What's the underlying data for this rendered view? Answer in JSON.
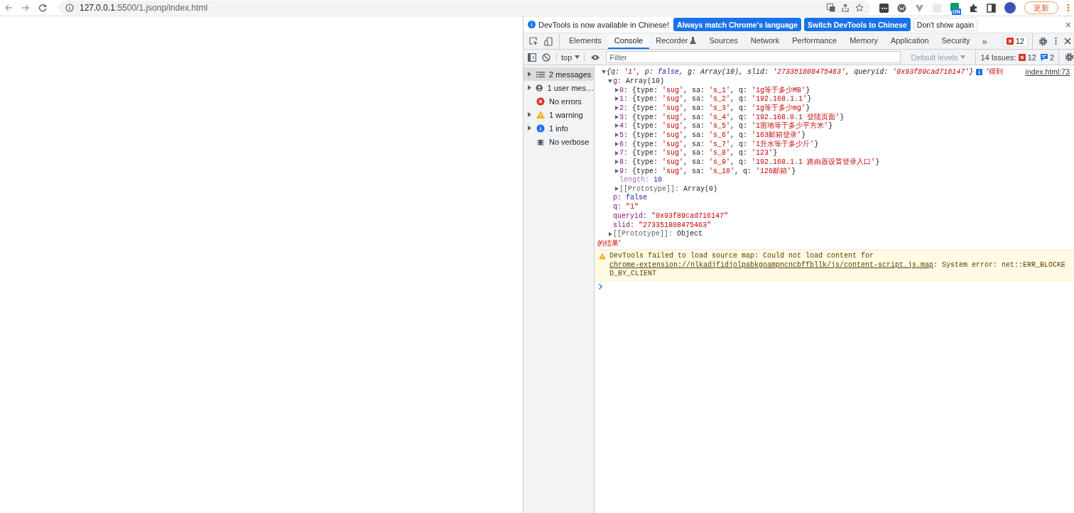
{
  "browser": {
    "address_host": "127.0.0.1",
    "address_rest": ":5500/1.jsonp/index.html",
    "extension_badge": "ON",
    "update_button": "更新"
  },
  "infobar": {
    "message": "DevTools is now available in Chinese!",
    "buttons": [
      {
        "label": "Always match Chrome's language",
        "kind": "primary"
      },
      {
        "label": "Switch DevTools to Chinese",
        "kind": "primary"
      },
      {
        "label": "Don't show again",
        "kind": "plain"
      }
    ],
    "close": "×"
  },
  "tabs": [
    {
      "label": "Elements",
      "selected": false,
      "experimental": false
    },
    {
      "label": "Console",
      "selected": true,
      "experimental": false
    },
    {
      "label": "Recorder",
      "selected": false,
      "experimental": true
    },
    {
      "label": "Sources",
      "selected": false,
      "experimental": false
    },
    {
      "label": "Network",
      "selected": false,
      "experimental": false
    },
    {
      "label": "Performance",
      "selected": false,
      "experimental": false
    },
    {
      "label": "Memory",
      "selected": false,
      "experimental": false
    },
    {
      "label": "Application",
      "selected": false,
      "experimental": false
    },
    {
      "label": "Security",
      "selected": false,
      "experimental": false
    }
  ],
  "more_tabs": "»",
  "error_count": "12",
  "console_toolbar": {
    "context": "top",
    "filter_placeholder": "Filter",
    "levels": "Default levels",
    "issues_label": "14 Issues:",
    "issue_errors": "12",
    "issue_infos": "2"
  },
  "sidebar": [
    {
      "label": "2 messages",
      "kind": "list",
      "expandable": true,
      "selected": true
    },
    {
      "label": "1 user mes…",
      "kind": "user",
      "expandable": true,
      "selected": false
    },
    {
      "label": "No errors",
      "kind": "error",
      "expandable": false,
      "selected": false
    },
    {
      "label": "1 warning",
      "kind": "warning",
      "expandable": true,
      "selected": false
    },
    {
      "label": "1 info",
      "kind": "info",
      "expandable": true,
      "selected": false
    },
    {
      "label": "No verbose",
      "kind": "verbose",
      "expandable": false,
      "selected": false
    }
  ],
  "messages": [
    {
      "kind": "log",
      "source": "index.html:73",
      "text_start": "'得到",
      "text_end": "的结果'",
      "tree": {
        "summary": "{q: '1', p: false, g: Array(10), slid: '273351808475463', queryid: '0x93f89cad716147'}",
        "expanded": true,
        "children": [
          {
            "key": "g:",
            "value": "Array(10)",
            "kind": "property",
            "expanded": true,
            "children": [
              {
                "key": "0:",
                "value": "{type: 'sug', sa: 's_1', q: '1g等于多少MB'}",
                "kind": "property",
                "expanded": false
              },
              {
                "key": "1:",
                "value": "{type: 'sug', sa: 's_2', q: '192.168.1.1'}",
                "kind": "property",
                "expanded": false
              },
              {
                "key": "2:",
                "value": "{type: 'sug', sa: 's_3', q: '1g等于多少mg'}",
                "kind": "property",
                "expanded": false
              },
              {
                "key": "3:",
                "value": "{type: 'sug', sa: 's_4', q: '192.168.0.1 登陆页面'}",
                "kind": "property",
                "expanded": false
              },
              {
                "key": "4:",
                "value": "{type: 'sug', sa: 's_5', q: '1亩地等于多少平方米'}",
                "kind": "property",
                "expanded": false
              },
              {
                "key": "5:",
                "value": "{type: 'sug', sa: 's_6', q: '163邮箱登录'}",
                "kind": "property",
                "expanded": false
              },
              {
                "key": "6:",
                "value": "{type: 'sug', sa: 's_7', q: '1升水等于多少斤'}",
                "kind": "property",
                "expanded": false
              },
              {
                "key": "7:",
                "value": "{type: 'sug', sa: 's_8', q: '123'}",
                "kind": "property",
                "expanded": false
              },
              {
                "key": "8:",
                "value": "{type: 'sug', sa: 's_9', q: '192.168.1.1 路由器设置登录入口'}",
                "kind": "property",
                "expanded": false
              },
              {
                "key": "9:",
                "value": "{type: 'sug', sa: 's_10', q: '126邮箱'}",
                "kind": "property",
                "expanded": false
              },
              {
                "key": "length:",
                "value": "10",
                "kind": "hidden"
              },
              {
                "key": "[[Prototype]]:",
                "value": "Array(0)",
                "kind": "internal",
                "expanded": false
              }
            ]
          },
          {
            "key": "p:",
            "value": "false",
            "kind": "property"
          },
          {
            "key": "q:",
            "value": "\"1\"",
            "kind": "property"
          },
          {
            "key": "queryid:",
            "value": "\"0x93f89cad716147\"",
            "kind": "property"
          },
          {
            "key": "slid:",
            "value": "\"273351808475463\"",
            "kind": "property"
          },
          {
            "key": "[[Prototype]]:",
            "value": "Object",
            "kind": "internal",
            "expanded": false
          }
        ]
      }
    },
    {
      "kind": "warning",
      "text": "DevTools failed to load source map: Could not load content for ",
      "link": "chrome-extension://nlkadjfidjolpabkgoampncncbffbllk/js/content-script.js.map",
      "text_after": ": System error: net::ERR_BLOCKED_BY_CLIENT"
    }
  ]
}
